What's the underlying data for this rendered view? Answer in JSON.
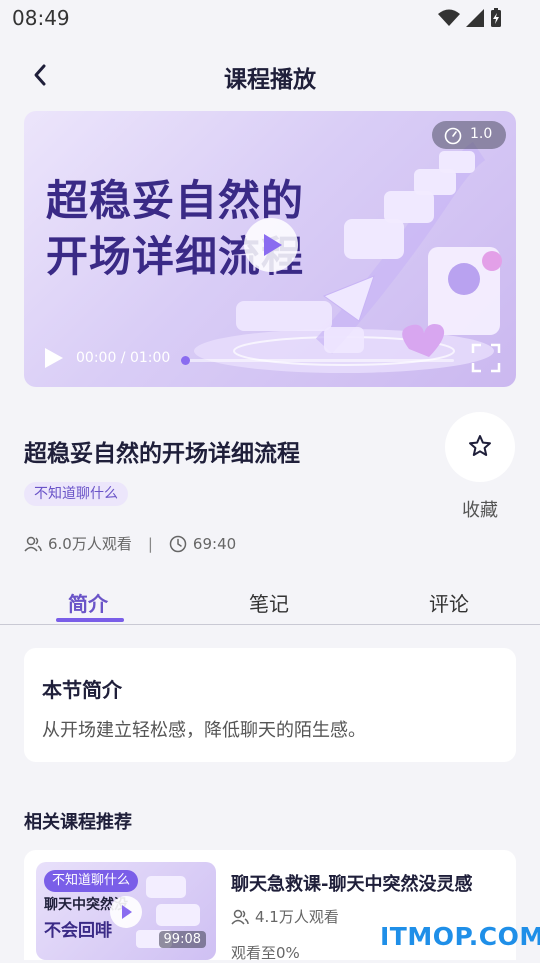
{
  "status_bar": {
    "time": "08:49"
  },
  "header": {
    "title": "课程播放"
  },
  "player": {
    "thumbnail_text_line1": "超稳妥自然的",
    "thumbnail_text_line2": "开场详细流程",
    "speed": "1.0",
    "time_display": "00:00 / 01:00",
    "progress_fraction": 0
  },
  "course": {
    "title": "超稳妥自然的开场详细流程",
    "tag": "不知道聊什么",
    "views": "6.0万人观看",
    "separator": "|",
    "duration": "69:40",
    "favorite_label": "收藏"
  },
  "tabs": [
    {
      "label": "简介",
      "active": true
    },
    {
      "label": "笔记",
      "active": false
    },
    {
      "label": "评论",
      "active": false
    }
  ],
  "intro": {
    "title": "本节简介",
    "text": "从开场建立轻松感，降低聊天的陌生感。"
  },
  "recommendations": {
    "section_title": "相关课程推荐",
    "items": [
      {
        "tag": "不知道聊什么",
        "thumb_line1": "聊天中突然没",
        "thumb_line2": "不会回啡",
        "duration": "99:08",
        "title": "聊天急救课-聊天中突然没灵感",
        "views": "4.1万人观看",
        "progress": "观看至0%"
      }
    ]
  },
  "watermark": "ITMOP.COM",
  "colors": {
    "accent": "#7a5ee8",
    "tag_bg": "#ece6fb",
    "background": "#f4f4f8"
  }
}
